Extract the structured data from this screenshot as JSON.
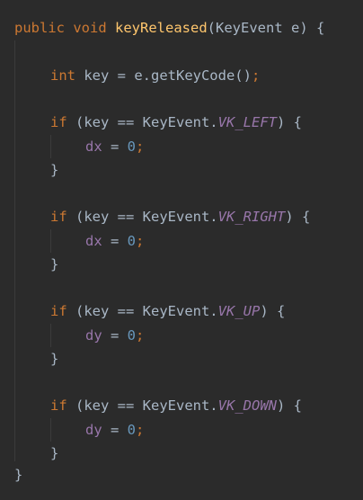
{
  "editor": {
    "signature": {
      "kw_public": "public",
      "kw_void": "void",
      "method_name": "keyReleased",
      "params": "(KeyEvent e) {"
    },
    "decl": {
      "kw_int": "int",
      "rest": " key = e.getKeyCode()",
      "semi": ";"
    },
    "blocks": [
      {
        "kw_if": "if",
        "cond_start": " (key == KeyEvent.",
        "constant": "VK_LEFT",
        "cond_end": ") {",
        "var": "dx",
        "assign": " = ",
        "value": "0",
        "semi": ";",
        "close": "}"
      },
      {
        "kw_if": "if",
        "cond_start": " (key == KeyEvent.",
        "constant": "VK_RIGHT",
        "cond_end": ") {",
        "var": "dx",
        "assign": " = ",
        "value": "0",
        "semi": ";",
        "close": "}"
      },
      {
        "kw_if": "if",
        "cond_start": " (key == KeyEvent.",
        "constant": "VK_UP",
        "cond_end": ") {",
        "var": "dy",
        "assign": " = ",
        "value": "0",
        "semi": ";",
        "close": "}"
      },
      {
        "kw_if": "if",
        "cond_start": " (key == KeyEvent.",
        "constant": "VK_DOWN",
        "cond_end": ") {",
        "var": "dy",
        "assign": " = ",
        "value": "0",
        "semi": ";",
        "close": "}"
      }
    ],
    "method_close": "}",
    "colors": {
      "background": "#2b2b2b",
      "keyword": "#cc7832",
      "method": "#ffc66d",
      "text": "#a9b7c6",
      "field": "#9876aa",
      "number": "#6897bb"
    }
  }
}
